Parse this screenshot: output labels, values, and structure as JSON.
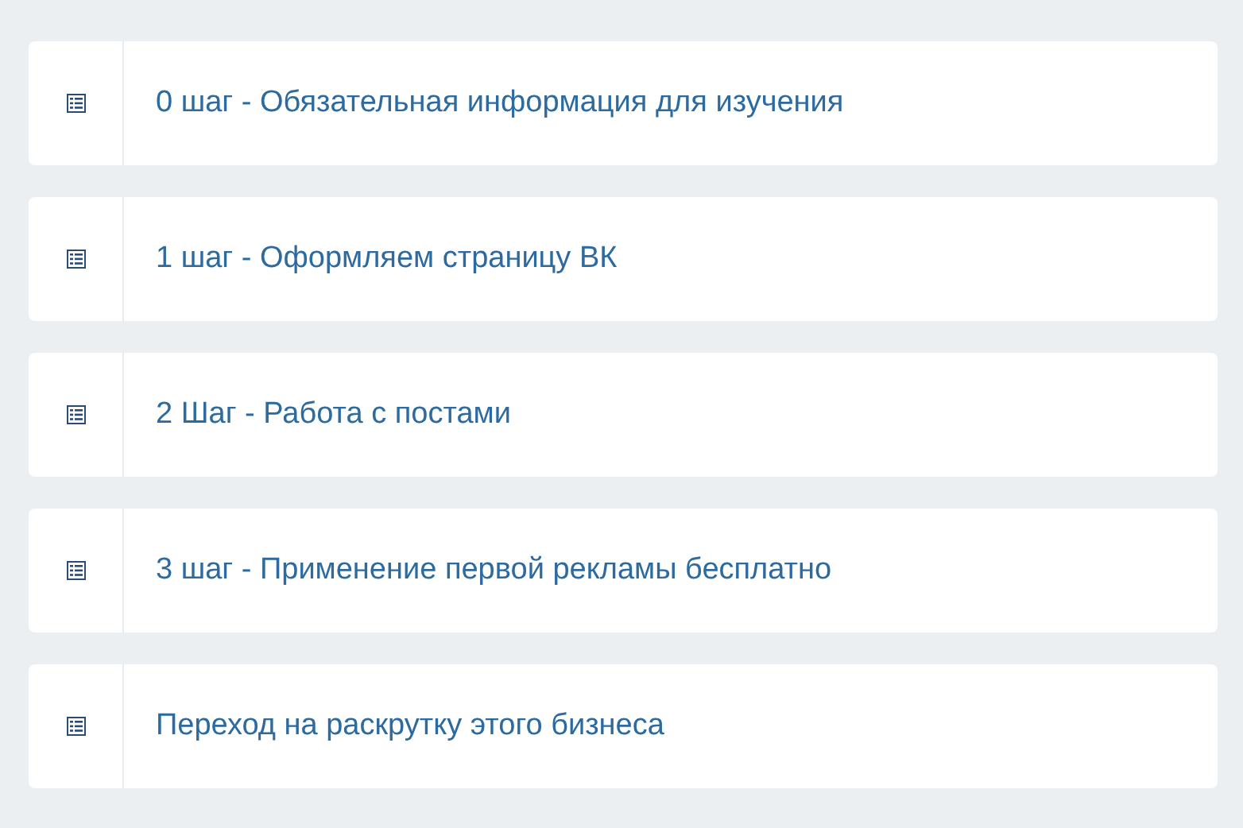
{
  "lessons": [
    {
      "title": "0 шаг - Обязательная информация для изучения"
    },
    {
      "title": "1 шаг - Оформляем страницу ВК"
    },
    {
      "title": "2 Шаг - Работа с постами"
    },
    {
      "title": "3 шаг - Применение первой рекламы бесплатно"
    },
    {
      "title": "Переход на раскрутку этого бизнеса"
    }
  ]
}
